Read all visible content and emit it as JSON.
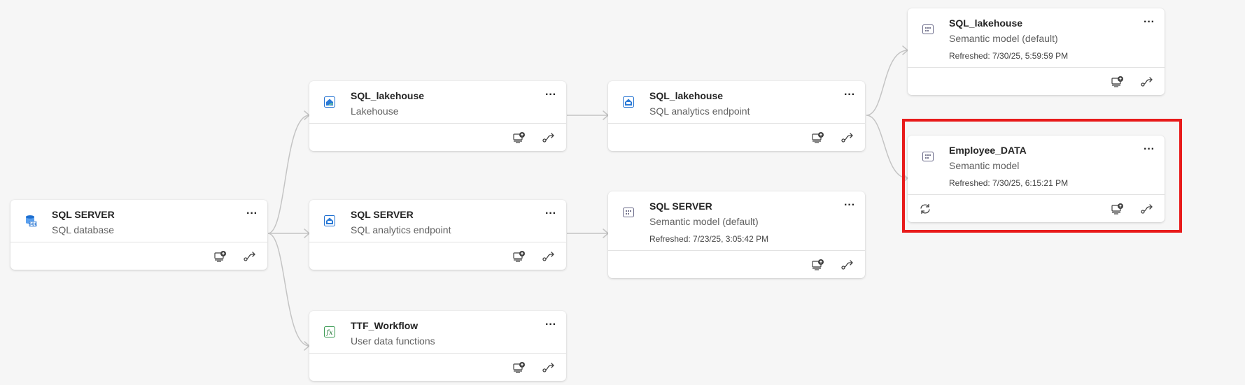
{
  "nodes": [
    {
      "id": "sqlserver-db",
      "title": "SQL SERVER",
      "subtitle": "SQL database",
      "refreshed": "",
      "icon": "sql-database-icon"
    },
    {
      "id": "lakehouse",
      "title": "SQL_lakehouse",
      "subtitle": "Lakehouse",
      "refreshed": "",
      "icon": "lakehouse-icon"
    },
    {
      "id": "sqlserver-endpoint",
      "title": "SQL SERVER",
      "subtitle": "SQL analytics endpoint",
      "refreshed": "",
      "icon": "sql-analytics-endpoint-icon"
    },
    {
      "id": "ttf-workflow",
      "title": "TTF_Workflow",
      "subtitle": "User data functions",
      "refreshed": "",
      "icon": "user-data-functions-icon"
    },
    {
      "id": "lakehouse-endpoint",
      "title": "SQL_lakehouse",
      "subtitle": "SQL analytics endpoint",
      "refreshed": "",
      "icon": "sql-analytics-endpoint-icon"
    },
    {
      "id": "sqlserver-model",
      "title": "SQL SERVER",
      "subtitle": "Semantic model (default)",
      "refreshed": "Refreshed: 7/23/25, 3:05:42 PM",
      "icon": "semantic-model-icon"
    },
    {
      "id": "lakehouse-model",
      "title": "SQL_lakehouse",
      "subtitle": "Semantic model (default)",
      "refreshed": "Refreshed: 7/30/25, 5:59:59 PM",
      "icon": "semantic-model-icon"
    },
    {
      "id": "employee-model",
      "title": "Employee_DATA",
      "subtitle": "Semantic model",
      "refreshed": "Refreshed: 7/30/25, 6:15:21 PM",
      "icon": "semantic-model-icon"
    }
  ],
  "more_label": "···",
  "accent": "#0f6cbd",
  "highlight_color": "#e81b1b"
}
